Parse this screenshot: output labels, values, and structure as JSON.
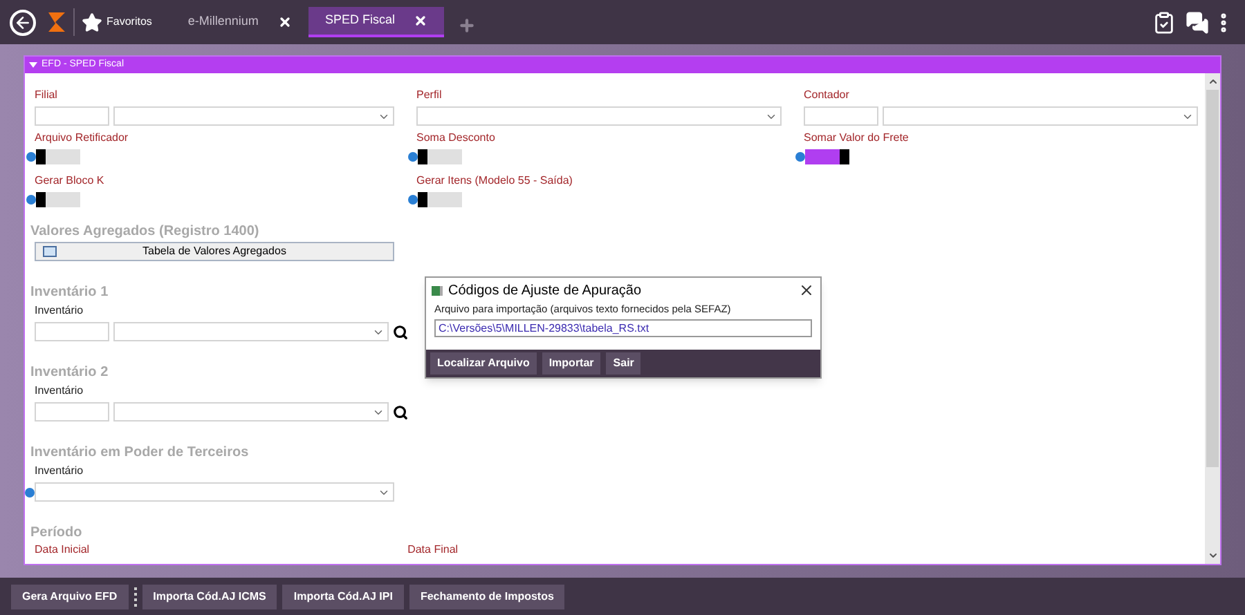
{
  "top_bar": {
    "tabs": [
      {
        "label": "Favoritos",
        "kind": "favorites",
        "selected": false
      },
      {
        "label": "e-Millennium",
        "kind": "tab",
        "selected": false
      },
      {
        "label": "SPED Fiscal",
        "kind": "tab",
        "selected": true
      }
    ]
  },
  "panel": {
    "title": "EFD - SPED Fiscal",
    "expanded": true,
    "fields": [
      {
        "kind": "lookup",
        "label": "Filial"
      },
      {
        "kind": "select",
        "label": "Perfil"
      },
      {
        "kind": "lookup",
        "label": "Contador"
      },
      {
        "kind": "toggle",
        "label": "Arquivo Retificador",
        "on": false
      },
      {
        "kind": "toggle",
        "label": "Soma Desconto",
        "on": false
      },
      {
        "kind": "toggle",
        "label": "Somar Valor do Frete",
        "on": true
      },
      {
        "kind": "toggle",
        "label": "Gerar Bloco K",
        "on": false
      },
      {
        "kind": "toggle",
        "label": "Gerar Itens (Modelo 55 - Saída)",
        "on": false
      }
    ],
    "sections": [
      {
        "title": "Valores Agregados (Registro 1400)",
        "kind": "button",
        "button": "Tabela de Valores Agregados"
      },
      {
        "title": "Inventário 1",
        "kind": "lookup_search",
        "field_label": "Inventário"
      },
      {
        "title": "Inventário 2",
        "kind": "lookup_search",
        "field_label": "Inventário"
      },
      {
        "title": "Inventário em Poder de Terceiros",
        "kind": "select_help",
        "field_label": "Inventário"
      },
      {
        "title": "Período",
        "kind": "dates",
        "labels": [
          "Data Inicial",
          "Data Final"
        ]
      }
    ]
  },
  "dialog": {
    "title": "Códigos de Ajuste de Apuração",
    "group_label": "Arquivo para importação (arquivos texto fornecidos pela SEFAZ)",
    "path": "C:\\Versões\\5\\MILLEN-29833\\tabela_RS.txt",
    "buttons": [
      "Localizar Arquivo",
      "Importar",
      "Sair"
    ]
  },
  "bottom_toolbar": {
    "buttons": [
      "Gera Arquivo EFD",
      "Importa Cód.AJ ICMS",
      "Importa Cód.AJ IPI",
      "Fechamento de Impostos"
    ]
  }
}
